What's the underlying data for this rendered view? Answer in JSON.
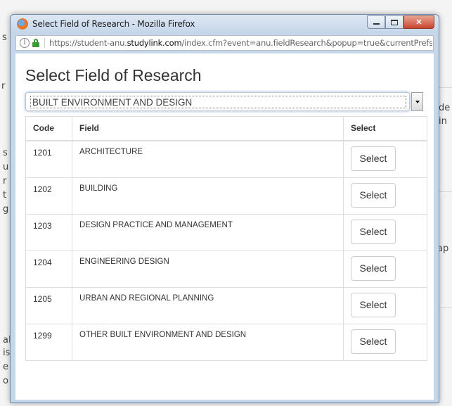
{
  "window": {
    "title": "Select Field of Research - Mozilla Firefox",
    "close_glyph": "✕"
  },
  "urlbar": {
    "info_glyph": "i",
    "url_prefix": "https://student-anu.",
    "url_domain": "studylink.com",
    "url_suffix": "/index.cfm?event=anu.fieldResearch&popup=true&currentPrefs=["
  },
  "page": {
    "heading": "Select Field of Research",
    "division_select": {
      "selected": "BUILT ENVIRONMENT AND DESIGN"
    }
  },
  "table": {
    "headers": {
      "code": "Code",
      "field": "Field",
      "select": "Select"
    },
    "rows": [
      {
        "code": "1201",
        "field": "ARCHITECTURE",
        "button": "Select"
      },
      {
        "code": "1202",
        "field": "BUILDING",
        "button": "Select"
      },
      {
        "code": "1203",
        "field": "DESIGN PRACTICE AND MANAGEMENT",
        "button": "Select"
      },
      {
        "code": "1204",
        "field": "ENGINEERING DESIGN",
        "button": "Select"
      },
      {
        "code": "1205",
        "field": "URBAN AND REGIONAL PLANNING",
        "button": "Select"
      },
      {
        "code": "1299",
        "field": "OTHER BUILT ENVIRONMENT AND DESIGN",
        "button": "Select"
      }
    ]
  },
  "background_fragments": [
    "s",
    "r",
    "de",
    "in",
    "s",
    "u",
    "r",
    "t",
    "g",
    "ap",
    "al",
    "is",
    "e",
    "o"
  ]
}
